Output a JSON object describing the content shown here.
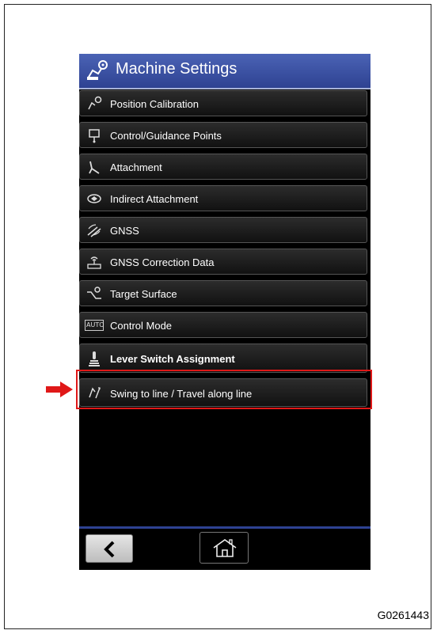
{
  "header": {
    "title": "Machine Settings",
    "icon": "machine-settings-icon"
  },
  "menu": {
    "items": [
      {
        "label": "Position Calibration",
        "icon": "position-calibration-icon"
      },
      {
        "label": "Control/Guidance Points",
        "icon": "control-points-icon"
      },
      {
        "label": "Attachment",
        "icon": "attachment-icon"
      },
      {
        "label": "Indirect Attachment",
        "icon": "indirect-attachment-icon"
      },
      {
        "label": "GNSS",
        "icon": "gnss-icon"
      },
      {
        "label": "GNSS Correction Data",
        "icon": "gnss-correction-icon"
      },
      {
        "label": "Target Surface",
        "icon": "target-surface-icon"
      },
      {
        "label": "Control Mode",
        "icon": "auto-icon",
        "icon_text": "AUTO"
      },
      {
        "label": "Lever Switch Assignment",
        "icon": "lever-switch-icon"
      },
      {
        "label": "Swing to line / Travel along line",
        "icon": "swing-travel-icon"
      }
    ]
  },
  "footer": {
    "back_icon": "chevron-left-icon",
    "home_icon": "home-icon"
  },
  "annotation": {
    "highlight_color": "#e01818",
    "arrow_color": "#e01818"
  },
  "figure_id": "G0261443",
  "colors": {
    "titlebar": "#3a50a3",
    "background": "#000000",
    "accent": "#2e4292"
  }
}
